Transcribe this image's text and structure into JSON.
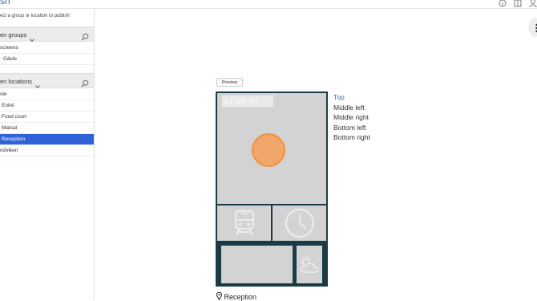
{
  "header": {
    "title": "sh"
  },
  "sidebar": {
    "hint": "ect a group or location to publish",
    "groups": {
      "label": "en groups",
      "items": [
        {
          "label": "screens",
          "indent": 1
        },
        {
          "label": "Gävle",
          "indent": 2
        }
      ]
    },
    "locations": {
      "label": "en locations",
      "items": [
        {
          "label": "vle",
          "indent": 1,
          "selected": false
        },
        {
          "label": "Entré",
          "indent": 2,
          "selected": false
        },
        {
          "label": "Food court",
          "indent": 2,
          "selected": false
        },
        {
          "label": "Matsal",
          "indent": 2,
          "selected": false
        },
        {
          "label": "Reception",
          "indent": 2,
          "selected": true
        },
        {
          "label": "ndviken",
          "indent": 1,
          "selected": false
        }
      ]
    }
  },
  "preview": {
    "button_label": "Preview",
    "clock_text": "12:07:00",
    "zones": [
      {
        "label": "Top",
        "active": true
      },
      {
        "label": "Middle left",
        "active": false
      },
      {
        "label": "Middle right",
        "active": false
      },
      {
        "label": "Bottom left",
        "active": false
      },
      {
        "label": "Bottom right",
        "active": false
      }
    ],
    "location_name": "Reception"
  },
  "colors": {
    "accent": "#2f6fb3",
    "selection": "#2f62d8",
    "device_frame": "#1c3a46",
    "circle_fill": "#f1a66a",
    "circle_stroke": "#f0913f"
  },
  "icons": [
    "info-icon",
    "book-icon",
    "user-icon",
    "search-icon",
    "chevron-down-icon",
    "train-icon",
    "clock-icon",
    "weather-icon",
    "location-pin-icon",
    "more-menu-icon"
  ]
}
